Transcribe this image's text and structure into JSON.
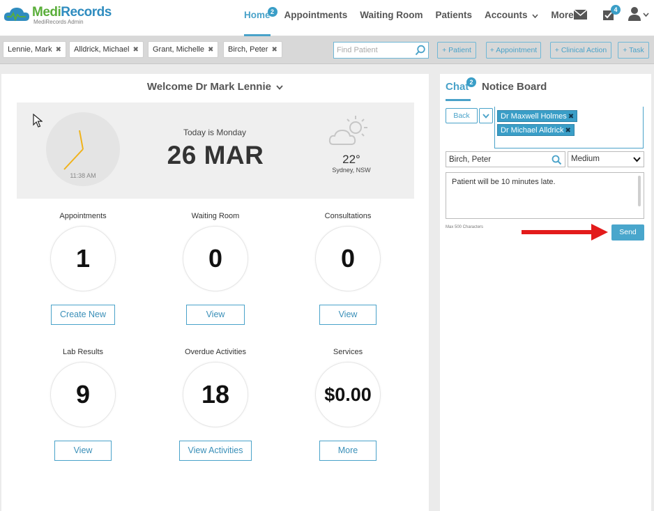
{
  "colors": {
    "accent": "#49a2c9",
    "logo_green": "#5aae3a",
    "logo_blue": "#2f8cbf",
    "arrow_red": "#e31b1b"
  },
  "logo": {
    "brand_part1": "Medi",
    "brand_part2": "Records",
    "subtitle": "MediRecords Admin"
  },
  "nav": {
    "items": [
      {
        "label": "Home",
        "badge": "2",
        "active": true
      },
      {
        "label": "Appointments"
      },
      {
        "label": "Waiting Room"
      },
      {
        "label": "Patients"
      },
      {
        "label": "Accounts"
      },
      {
        "label": "More"
      }
    ],
    "icons": {
      "mail": "envelope-icon",
      "tasks": "clipboard-check-icon",
      "tasks_badge": "4",
      "user": "user-icon"
    }
  },
  "patient_tabs": [
    "Lennie, Mark",
    "Alldrick, Michael",
    "Grant, Michelle",
    "Birch, Peter"
  ],
  "find_patient": {
    "placeholder": "Find Patient"
  },
  "quick_actions": [
    "+ Patient",
    "+ Appointment",
    "+ Clinical Action",
    "+ Task"
  ],
  "welcome": "Welcome Dr Mark Lennie",
  "clock": {
    "time": "11:38 AM"
  },
  "today": {
    "label": "Today is Monday",
    "date": "26 MAR"
  },
  "weather": {
    "temp": "22°",
    "location": "Sydney, NSW",
    "icon": "partly-cloudy-icon"
  },
  "stats": [
    {
      "label": "Appointments",
      "value": "1",
      "button": "Create New"
    },
    {
      "label": "Waiting Room",
      "value": "0",
      "button": "View"
    },
    {
      "label": "Consultations",
      "value": "0",
      "button": "View"
    },
    {
      "label": "Lab Results",
      "value": "9",
      "button": "View"
    },
    {
      "label": "Overdue Activities",
      "value": "18",
      "button": "View Activities"
    },
    {
      "label": "Services",
      "value": "$0.00",
      "button": "More"
    }
  ],
  "chat": {
    "tab_chat": "Chat",
    "tab_chat_badge": "2",
    "tab_notice": "Notice Board",
    "back": "Back",
    "recipients": [
      "Dr Maxwell Holmes",
      "Dr Michael Alldrick"
    ],
    "patient_value": "Birch, Peter",
    "priority": "Medium",
    "message": "Patient will be 10 minutes late.",
    "max_chars": "Max 500 Characters",
    "send": "Send"
  }
}
